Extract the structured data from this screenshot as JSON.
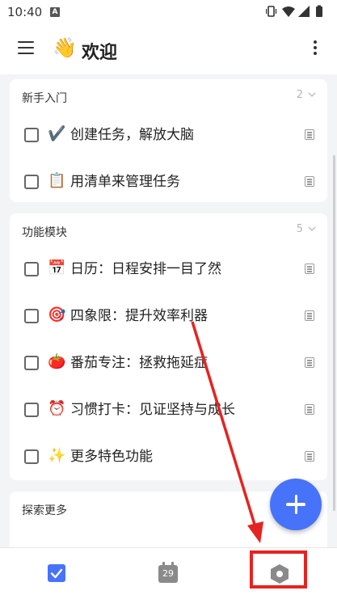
{
  "status_bar": {
    "time": "10:40",
    "notification_glyph": "A",
    "icons": [
      "vibrate-icon",
      "wifi-icon",
      "signal-icon",
      "battery-icon"
    ]
  },
  "app_bar": {
    "menu_icon": "hamburger-icon",
    "emoji": "👋",
    "title": "欢迎",
    "more_icon": "overflow-menu-icon"
  },
  "sections": [
    {
      "title": "新手入门",
      "count": "2",
      "items": [
        {
          "emoji": "✔️",
          "text": "创建任务，解放大脑"
        },
        {
          "emoji": "📋",
          "text": "用清单来管理任务"
        }
      ]
    },
    {
      "title": "功能模块",
      "count": "5",
      "items": [
        {
          "emoji": "📅",
          "text": "日历：日程安排一目了然"
        },
        {
          "emoji": "🎯",
          "text": "四象限：提升效率利器"
        },
        {
          "emoji": "🍅",
          "text": "番茄专注：拯救拖延症"
        },
        {
          "emoji": "⏰",
          "text": "习惯打卡：见证坚持与成长"
        },
        {
          "emoji": "✨",
          "text": "更多特色功能"
        }
      ]
    },
    {
      "title": "探索更多",
      "count": "",
      "items": []
    }
  ],
  "fab": {
    "icon": "plus-icon"
  },
  "bottom_nav": {
    "tabs": [
      {
        "icon": "task-checkbox-icon",
        "active": true
      },
      {
        "icon": "calendar-icon",
        "label": "29",
        "active": false
      },
      {
        "icon": "more-hexagon-icon",
        "active": false
      }
    ]
  },
  "colors": {
    "accent": "#4772fa",
    "annotation": "#e52320",
    "background": "#f3f4f6"
  }
}
